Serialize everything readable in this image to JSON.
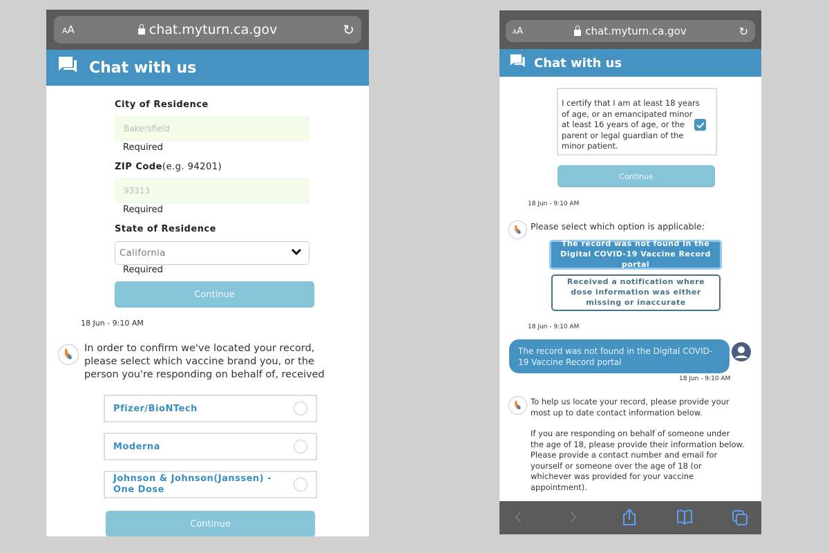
{
  "left_phone": {
    "browser": {
      "text_size_label": "AA",
      "url": "chat.myturn.ca.gov"
    },
    "header": {
      "title": "Chat with us"
    },
    "form": {
      "city": {
        "label": "City of Residence",
        "value": "Bakersfield",
        "hint": "Required"
      },
      "zip": {
        "label": "ZIP Code",
        "label_example": "(e.g. 94201)",
        "value": "93313",
        "hint": "Required"
      },
      "state": {
        "label": "State of Residence",
        "value": "California",
        "hint": "Required"
      },
      "continue_label": "Continue"
    },
    "timestamp": "18 Jun - 9:10 AM",
    "bot_message": "In order to confirm we've located your record, please select which vaccine brand you, or the person you're responding on behalf of, received",
    "vaccine_options": [
      {
        "label": "Pfizer/BioNTech",
        "selected": false
      },
      {
        "label": "Moderna",
        "selected": false
      },
      {
        "label": "Johnson & Johnson(Janssen) - One Dose",
        "selected": false
      }
    ],
    "continue_label_2": "Continue"
  },
  "right_phone": {
    "browser": {
      "text_size_label": "AA",
      "url": "chat.myturn.ca.gov"
    },
    "header": {
      "title": "Chat with us"
    },
    "certify": {
      "text": "I certify that I am at least 18 years of age, or an emancipated minor at least 16 years of age, or the parent or legal guardian of the minor patient.",
      "checked": true
    },
    "continue_label": "Continue",
    "timestamp_1": "18 Jun - 9:10 AM",
    "bot_message_1": "Please select which option is applicable:",
    "options": [
      {
        "label": "The record was not found in the Digital COVID-19 Vaccine Record portal",
        "selected": true
      },
      {
        "label": "Received a notification where dose information was either missing or inaccurate",
        "selected": false
      }
    ],
    "timestamp_2": "18 Jun - 9:10 AM",
    "user_message": "The record was not found in the Digital COVID-19 Vaccine Record portal",
    "timestamp_3": "18 Jun - 9:10 AM",
    "bot_message_2a": "To help us locate your record, please provide your most up to date contact information below.",
    "bot_message_2b": "If you are responding on behalf of someone under the age of 18, please provide their information below. Please provide a contact number and email for yourself or someone over the age of 18 (or whichever was provided for your vaccine appointment).",
    "toolbar": [
      "back",
      "forward",
      "share",
      "bookmarks",
      "tabs"
    ]
  },
  "colors": {
    "brand_blue": "#4593c3",
    "button_disabled": "#86c4d8",
    "input_bg": "#f4fde9",
    "chrome_gray": "#5a5a5a"
  }
}
